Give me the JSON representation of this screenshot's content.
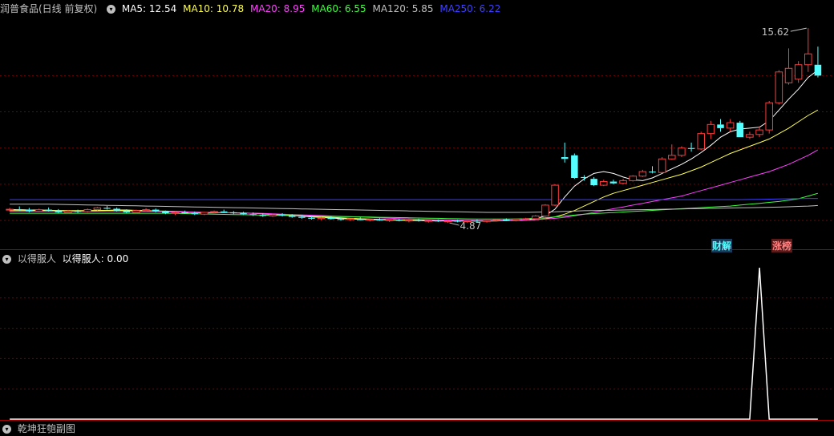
{
  "main_header": {
    "stock_name": "润普食品(日线 前复权)",
    "ma": [
      {
        "label": "MA5: 12.54",
        "color": "#ffffff"
      },
      {
        "label": "MA10: 10.78",
        "color": "#ffff54"
      },
      {
        "label": "MA20: 8.95",
        "color": "#ff40ff"
      },
      {
        "label": "MA60: 6.55",
        "color": "#40ff40"
      },
      {
        "label": "MA120: 5.85",
        "color": "#c0c0c0"
      },
      {
        "label": "MA250: 6.22",
        "color": "#4040ff"
      }
    ]
  },
  "sub_header": {
    "name": "以得服人",
    "value_label": "以得服人: 0.00"
  },
  "bottom_header": {
    "name": "乾坤狂匏副图"
  },
  "badges": {
    "finance": "财解",
    "limit": "涨榜"
  },
  "annotations": {
    "high": "15.62",
    "low": "4.87"
  },
  "colors": {
    "up": "#ff3b3b",
    "down": "#54ffff",
    "grid": "#7a0000",
    "border": "#a00000"
  },
  "chart_data": [
    {
      "type": "candlestick",
      "title": "润普食品(日线 前复权)",
      "ylim": [
        3.9,
        16.2
      ],
      "high_label": 15.62,
      "low_label": 4.87,
      "candles_ohlc": [
        [
          5.58,
          5.7,
          5.5,
          5.62
        ],
        [
          5.62,
          5.78,
          5.55,
          5.6
        ],
        [
          5.6,
          5.7,
          5.45,
          5.52
        ],
        [
          5.52,
          5.65,
          5.48,
          5.6
        ],
        [
          5.6,
          5.72,
          5.5,
          5.55
        ],
        [
          5.55,
          5.63,
          5.4,
          5.45
        ],
        [
          5.45,
          5.58,
          5.4,
          5.52
        ],
        [
          5.52,
          5.6,
          5.42,
          5.5
        ],
        [
          5.5,
          5.66,
          5.45,
          5.6
        ],
        [
          5.6,
          5.75,
          5.55,
          5.7
        ],
        [
          5.7,
          5.8,
          5.6,
          5.65
        ],
        [
          5.65,
          5.72,
          5.5,
          5.55
        ],
        [
          5.55,
          5.62,
          5.4,
          5.45
        ],
        [
          5.45,
          5.6,
          5.4,
          5.55
        ],
        [
          5.55,
          5.68,
          5.5,
          5.6
        ],
        [
          5.6,
          5.66,
          5.45,
          5.5
        ],
        [
          5.5,
          5.55,
          5.35,
          5.4
        ],
        [
          5.4,
          5.5,
          5.3,
          5.45
        ],
        [
          5.45,
          5.55,
          5.38,
          5.4
        ],
        [
          5.4,
          5.5,
          5.3,
          5.35
        ],
        [
          5.35,
          5.48,
          5.3,
          5.45
        ],
        [
          5.45,
          5.55,
          5.4,
          5.5
        ],
        [
          5.5,
          5.6,
          5.42,
          5.45
        ],
        [
          5.45,
          5.52,
          5.35,
          5.4
        ],
        [
          5.4,
          5.48,
          5.3,
          5.35
        ],
        [
          5.35,
          5.45,
          5.25,
          5.3
        ],
        [
          5.3,
          5.4,
          5.2,
          5.25
        ],
        [
          5.25,
          5.38,
          5.2,
          5.32
        ],
        [
          5.32,
          5.4,
          5.22,
          5.28
        ],
        [
          5.28,
          5.35,
          5.15,
          5.2
        ],
        [
          5.2,
          5.3,
          5.1,
          5.15
        ],
        [
          5.15,
          5.25,
          5.05,
          5.1
        ],
        [
          5.1,
          5.2,
          5.02,
          5.15
        ],
        [
          5.15,
          5.22,
          5.05,
          5.08
        ],
        [
          5.08,
          5.15,
          5.0,
          5.05
        ],
        [
          5.05,
          5.12,
          4.98,
          5.1
        ],
        [
          5.1,
          5.18,
          5.0,
          5.02
        ],
        [
          5.02,
          5.1,
          4.95,
          5.06
        ],
        [
          5.06,
          5.12,
          4.98,
          5.0
        ],
        [
          5.0,
          5.08,
          4.92,
          5.04
        ],
        [
          5.04,
          5.1,
          4.95,
          4.98
        ],
        [
          4.98,
          5.06,
          4.9,
          5.02
        ],
        [
          5.02,
          5.1,
          4.94,
          4.96
        ],
        [
          4.96,
          5.02,
          4.88,
          5.0
        ],
        [
          5.0,
          5.06,
          4.92,
          4.95
        ],
        [
          4.95,
          5.02,
          4.87,
          4.98
        ],
        [
          4.98,
          5.05,
          4.9,
          4.94
        ],
        [
          4.94,
          5.0,
          4.87,
          4.99
        ],
        [
          4.99,
          5.05,
          4.9,
          4.95
        ],
        [
          4.95,
          5.02,
          4.88,
          5.0
        ],
        [
          5.0,
          5.08,
          4.95,
          5.05
        ],
        [
          5.05,
          5.12,
          4.98,
          5.02
        ],
        [
          5.02,
          5.1,
          4.95,
          5.08
        ],
        [
          5.08,
          5.15,
          5.0,
          5.1
        ],
        [
          5.1,
          5.3,
          5.05,
          5.25
        ],
        [
          5.25,
          5.9,
          5.2,
          5.85
        ],
        [
          5.85,
          7.0,
          5.8,
          6.95
        ],
        [
          8.5,
          9.3,
          8.2,
          8.4
        ],
        [
          8.6,
          8.7,
          7.3,
          7.35
        ],
        [
          7.4,
          7.5,
          7.2,
          7.35
        ],
        [
          7.3,
          7.4,
          6.9,
          6.95
        ],
        [
          6.95,
          7.25,
          6.9,
          7.15
        ],
        [
          7.15,
          7.25,
          7.0,
          7.05
        ],
        [
          7.05,
          7.3,
          7.0,
          7.2
        ],
        [
          7.2,
          7.5,
          7.15,
          7.45
        ],
        [
          7.45,
          7.8,
          7.4,
          7.7
        ],
        [
          7.7,
          8.0,
          7.6,
          7.65
        ],
        [
          7.65,
          8.5,
          7.6,
          8.4
        ],
        [
          8.4,
          9.2,
          8.35,
          8.6
        ],
        [
          8.6,
          9.1,
          8.5,
          9.0
        ],
        [
          9.0,
          9.3,
          8.8,
          8.95
        ],
        [
          8.95,
          9.9,
          8.9,
          9.8
        ],
        [
          9.8,
          10.5,
          9.5,
          10.3
        ],
        [
          10.3,
          10.6,
          9.9,
          10.1
        ],
        [
          10.1,
          10.6,
          9.9,
          10.4
        ],
        [
          10.4,
          10.5,
          9.6,
          9.6
        ],
        [
          9.6,
          9.9,
          9.5,
          9.75
        ],
        [
          9.75,
          10.2,
          9.6,
          10.0
        ],
        [
          10.0,
          11.6,
          9.8,
          11.5
        ],
        [
          11.5,
          13.3,
          11.4,
          13.2
        ],
        [
          12.6,
          14.5,
          12.5,
          13.4
        ],
        [
          12.8,
          13.8,
          12.6,
          13.6
        ],
        [
          13.6,
          15.62,
          13.2,
          14.2
        ],
        [
          13.6,
          14.6,
          12.9,
          13.0
        ]
      ],
      "ma_lines": [
        {
          "name": "MA5",
          "color": "#ffffff",
          "values": [
            5.6,
            5.6,
            5.58,
            5.58,
            5.57,
            5.55,
            5.54,
            5.52,
            5.52,
            5.54,
            5.56,
            5.58,
            5.58,
            5.56,
            5.55,
            5.53,
            5.5,
            5.48,
            5.46,
            5.44,
            5.42,
            5.42,
            5.43,
            5.43,
            5.42,
            5.4,
            5.37,
            5.34,
            5.3,
            5.27,
            5.24,
            5.2,
            5.17,
            5.14,
            5.11,
            5.09,
            5.07,
            5.05,
            5.04,
            5.03,
            5.02,
            5.0,
            4.99,
            4.98,
            4.98,
            4.97,
            4.97,
            4.97,
            4.97,
            4.97,
            4.98,
            5.0,
            5.02,
            5.05,
            5.1,
            5.26,
            5.63,
            6.3,
            6.9,
            7.3,
            7.6,
            7.7,
            7.6,
            7.4,
            7.25,
            7.2,
            7.35,
            7.6,
            7.85,
            8.1,
            8.4,
            8.75,
            9.15,
            9.6,
            9.9,
            10.05,
            10.1,
            10.15,
            10.5,
            11.1,
            11.7,
            12.25,
            12.9,
            13.3
          ]
        },
        {
          "name": "MA10",
          "color": "#ffff54",
          "values": [
            5.55,
            5.55,
            5.55,
            5.55,
            5.55,
            5.55,
            5.55,
            5.55,
            5.55,
            5.56,
            5.56,
            5.56,
            5.56,
            5.55,
            5.54,
            5.53,
            5.52,
            5.5,
            5.48,
            5.46,
            5.45,
            5.44,
            5.43,
            5.42,
            5.41,
            5.4,
            5.38,
            5.35,
            5.32,
            5.3,
            5.27,
            5.24,
            5.21,
            5.18,
            5.15,
            5.12,
            5.1,
            5.08,
            5.06,
            5.05,
            5.03,
            5.02,
            5.01,
            5.0,
            4.99,
            4.99,
            4.98,
            4.98,
            4.98,
            4.98,
            4.98,
            4.99,
            5.0,
            5.02,
            5.04,
            5.1,
            5.2,
            5.35,
            5.55,
            5.8,
            6.05,
            6.3,
            6.5,
            6.65,
            6.8,
            6.95,
            7.1,
            7.25,
            7.4,
            7.55,
            7.75,
            7.95,
            8.2,
            8.45,
            8.7,
            8.9,
            9.1,
            9.3,
            9.5,
            9.8,
            10.1,
            10.45,
            10.8,
            11.1
          ]
        },
        {
          "name": "MA20",
          "color": "#ff40ff",
          "values": [
            5.5,
            5.5,
            5.5,
            5.5,
            5.5,
            5.5,
            5.5,
            5.5,
            5.5,
            5.5,
            5.5,
            5.5,
            5.5,
            5.5,
            5.5,
            5.5,
            5.49,
            5.48,
            5.47,
            5.46,
            5.45,
            5.44,
            5.43,
            5.42,
            5.41,
            5.4,
            5.39,
            5.37,
            5.35,
            5.33,
            5.31,
            5.29,
            5.27,
            5.25,
            5.23,
            5.21,
            5.19,
            5.17,
            5.15,
            5.13,
            5.11,
            5.09,
            5.07,
            5.05,
            5.04,
            5.03,
            5.02,
            5.01,
            5.0,
            5.0,
            5.0,
            5.01,
            5.02,
            5.03,
            5.05,
            5.08,
            5.12,
            5.18,
            5.26,
            5.35,
            5.45,
            5.55,
            5.65,
            5.75,
            5.85,
            5.95,
            6.05,
            6.15,
            6.25,
            6.35,
            6.5,
            6.65,
            6.8,
            6.95,
            7.1,
            7.25,
            7.4,
            7.55,
            7.7,
            7.9,
            8.1,
            8.35,
            8.6,
            8.9
          ]
        },
        {
          "name": "MA60",
          "color": "#40ff40",
          "values": [
            5.4,
            5.4,
            5.4,
            5.4,
            5.4,
            5.4,
            5.4,
            5.4,
            5.4,
            5.4,
            5.4,
            5.4,
            5.4,
            5.4,
            5.4,
            5.4,
            5.4,
            5.39,
            5.38,
            5.37,
            5.36,
            5.35,
            5.34,
            5.33,
            5.32,
            5.31,
            5.3,
            5.29,
            5.28,
            5.27,
            5.26,
            5.25,
            5.24,
            5.23,
            5.22,
            5.21,
            5.2,
            5.19,
            5.18,
            5.17,
            5.16,
            5.15,
            5.14,
            5.13,
            5.12,
            5.11,
            5.1,
            5.09,
            5.08,
            5.08,
            5.08,
            5.08,
            5.09,
            5.1,
            5.12,
            5.15,
            5.2,
            5.25,
            5.3,
            5.35,
            5.38,
            5.41,
            5.44,
            5.47,
            5.5,
            5.53,
            5.56,
            5.59,
            5.62,
            5.65,
            5.68,
            5.71,
            5.74,
            5.77,
            5.8,
            5.85,
            5.9,
            5.95,
            6.0,
            6.05,
            6.12,
            6.2,
            6.35,
            6.5
          ]
        },
        {
          "name": "MA120",
          "color": "#c0c0c0",
          "values": [
            5.9,
            5.9,
            5.9,
            5.9,
            5.9,
            5.89,
            5.88,
            5.87,
            5.86,
            5.85,
            5.84,
            5.83,
            5.82,
            5.81,
            5.8,
            5.79,
            5.78,
            5.77,
            5.76,
            5.75,
            5.74,
            5.73,
            5.72,
            5.71,
            5.7,
            5.69,
            5.68,
            5.67,
            5.66,
            5.65,
            5.64,
            5.63,
            5.62,
            5.61,
            5.6,
            5.59,
            5.58,
            5.57,
            5.56,
            5.55,
            5.54,
            5.53,
            5.52,
            5.51,
            5.5,
            5.49,
            5.48,
            5.47,
            5.46,
            5.45,
            5.45,
            5.45,
            5.45,
            5.45,
            5.46,
            5.47,
            5.48,
            5.5,
            5.52,
            5.54,
            5.55,
            5.56,
            5.57,
            5.58,
            5.59,
            5.6,
            5.61,
            5.62,
            5.63,
            5.64,
            5.65,
            5.66,
            5.67,
            5.68,
            5.69,
            5.7,
            5.71,
            5.72,
            5.73,
            5.74,
            5.76,
            5.78,
            5.8,
            5.83
          ]
        },
        {
          "name": "MA250",
          "color": "#4040ff",
          "values": [
            6.15,
            6.15,
            6.15,
            6.15,
            6.15,
            6.15,
            6.15,
            6.15,
            6.15,
            6.15,
            6.15,
            6.15,
            6.15,
            6.15,
            6.15,
            6.15,
            6.15,
            6.15,
            6.15,
            6.15,
            6.15,
            6.15,
            6.15,
            6.15,
            6.15,
            6.15,
            6.15,
            6.15,
            6.15,
            6.15,
            6.15,
            6.15,
            6.15,
            6.15,
            6.15,
            6.15,
            6.15,
            6.15,
            6.15,
            6.15,
            6.15,
            6.15,
            6.15,
            6.15,
            6.15,
            6.15,
            6.15,
            6.15,
            6.15,
            6.15,
            6.15,
            6.15,
            6.15,
            6.15,
            6.15,
            6.15,
            6.15,
            6.15,
            6.15,
            6.15,
            6.15,
            6.15,
            6.15,
            6.15,
            6.15,
            6.15,
            6.15,
            6.15,
            6.15,
            6.15,
            6.15,
            6.15,
            6.15,
            6.15,
            6.15,
            6.15,
            6.16,
            6.17,
            6.18,
            6.19,
            6.2,
            6.21,
            6.22,
            6.22
          ]
        }
      ]
    },
    {
      "type": "line",
      "title": "以得服人",
      "series": [
        {
          "name": "以得服人",
          "color": "#ffffff",
          "values": [
            0,
            0,
            0,
            0,
            0,
            0,
            0,
            0,
            0,
            0,
            0,
            0,
            0,
            0,
            0,
            0,
            0,
            0,
            0,
            0,
            0,
            0,
            0,
            0,
            0,
            0,
            0,
            0,
            0,
            0,
            0,
            0,
            0,
            0,
            0,
            0,
            0,
            0,
            0,
            0,
            0,
            0,
            0,
            0,
            0,
            0,
            0,
            0,
            0,
            0,
            0,
            0,
            0,
            0,
            0,
            0,
            0,
            0,
            0,
            0,
            0,
            0,
            0,
            0,
            0,
            0,
            0,
            0,
            0,
            0,
            0,
            0,
            0,
            0,
            0,
            0,
            0,
            1,
            0,
            0,
            0,
            0,
            0,
            0
          ]
        }
      ],
      "ylim": [
        0,
        1
      ]
    }
  ]
}
